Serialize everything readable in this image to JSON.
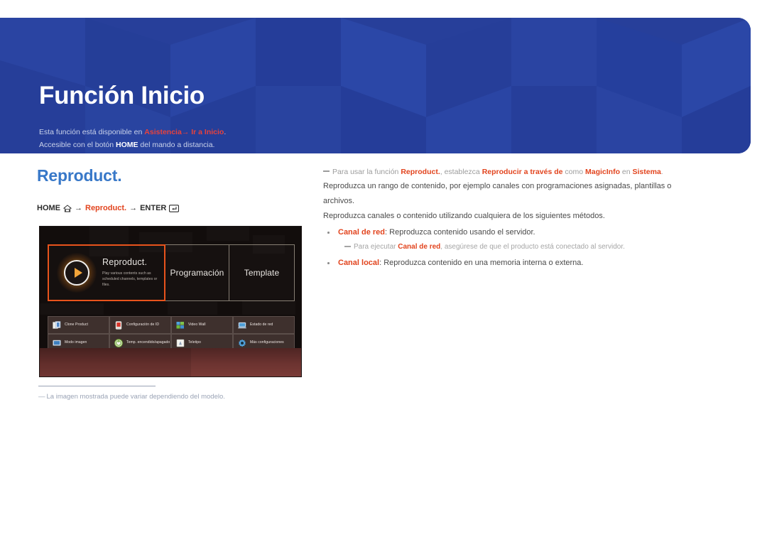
{
  "banner": {
    "title": "Función Inicio",
    "subtitle_line1_pre": "Esta función está disponible en ",
    "subtitle_line1_link1": "Asistencia",
    "subtitle_line1_arrow": "→",
    "subtitle_line1_link2": "Ir a Inicio",
    "subtitle_line1_post": ".",
    "subtitle_line2_pre": "Accesible con el botón ",
    "subtitle_line2_key": "HOME",
    "subtitle_line2_post": " del mando a distancia.",
    "bg_color": "#27409a",
    "accent_color": "#e8423c"
  },
  "left": {
    "section_title": "Reproduct.",
    "section_title_color": "#3878c8",
    "nav_home": "HOME",
    "nav_home_icon": "home-icon",
    "nav_arrow1": "→",
    "nav_target": "Reproduct.",
    "nav_arrow2": "→",
    "nav_enter": "ENTER",
    "nav_enter_icon": "enter-key-icon",
    "caption_dash": "—",
    "caption": "La imagen mostrada puede variar dependiendo del modelo."
  },
  "tv": {
    "tiles": [
      {
        "name": "reproduct",
        "title": "Reproduct.",
        "desc": "Play various contents such as scheduled channels, templates or files.",
        "selected": true,
        "icon": "play-circle-icon",
        "highlight_color": "#e8531c"
      },
      {
        "name": "programacion",
        "title": "Programación",
        "selected": false
      },
      {
        "name": "template",
        "title": "Template",
        "selected": false
      }
    ],
    "icon_grid": [
      {
        "label": "Clone Product",
        "icon": "clone-product-icon"
      },
      {
        "label": "Configuración de ID",
        "icon": "id-settings-icon"
      },
      {
        "label": "Video Wall",
        "icon": "video-wall-icon"
      },
      {
        "label": "Estado de red",
        "icon": "network-status-icon"
      },
      {
        "label": "Modo imagen",
        "icon": "picture-mode-icon"
      },
      {
        "label": "Temp. encendido/apagado",
        "icon": "on-off-timer-icon"
      },
      {
        "label": "Teletipo",
        "icon": "ticker-icon"
      },
      {
        "label": "Más configuraciones",
        "icon": "more-settings-icon"
      }
    ]
  },
  "right": {
    "note": {
      "pre": "Para usar la función ",
      "b1": "Reproduct.",
      "mid1": ", establezca ",
      "b2": "Reproducir a través de",
      "mid2": " como ",
      "b3": "MagicInfo",
      "mid3": " en ",
      "b4": "Sistema",
      "post": "."
    },
    "line1": "Reproduzca un rango de contenido, por ejemplo canales con programaciones asignadas, plantillas o archivos.",
    "line2": "Reproduzca canales o contenido utilizando cualquiera de los siguientes métodos.",
    "bullet1": {
      "label": "Canal de red",
      "text": ": Reproduzca contenido usando el servidor."
    },
    "subnote1": {
      "pre": "Para ejecutar ",
      "b1": "Canal de red",
      "post": ", asegúrese de que el producto está conectado al servidor."
    },
    "bullet2": {
      "label": "Canal local",
      "text": ": Reproduzca contenido en una memoria interna o externa."
    }
  }
}
